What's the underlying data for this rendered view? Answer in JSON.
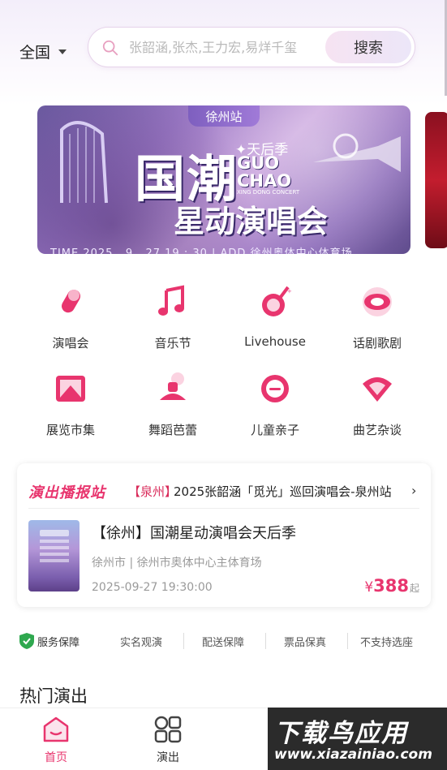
{
  "header": {
    "city": "全国",
    "search_placeholder": "张韶涵,张杰,王力宏,易烊千玺",
    "search_button": "搜索"
  },
  "banner": {
    "station": "徐州站",
    "title_line1": "国潮",
    "season": "✦天后季",
    "guo": "GUO",
    "chao": "CHAO",
    "sub_en": "XING DONG CONCERT",
    "title_line2": "星动演唱会",
    "time": "TIME 2025 . 9 . 27 19 : 30 | ADD 徐州奥体中心体育场"
  },
  "categories": [
    {
      "label": "演唱会",
      "icon": "microphone-icon"
    },
    {
      "label": "音乐节",
      "icon": "music-note-icon"
    },
    {
      "label": "Livehouse",
      "icon": "guitar-icon"
    },
    {
      "label": "话剧歌剧",
      "icon": "drama-mask-icon"
    },
    {
      "label": "展览市集",
      "icon": "picture-frame-icon"
    },
    {
      "label": "舞蹈芭蕾",
      "icon": "ballet-skirt-icon"
    },
    {
      "label": "儿童亲子",
      "icon": "child-face-icon"
    },
    {
      "label": "曲艺杂谈",
      "icon": "folding-fan-icon"
    }
  ],
  "broadcast": {
    "title": "演出播报站",
    "city_tag": "【泉州】",
    "text": "2025张韶涵「觅光」巡回演唱会-泉州站"
  },
  "show": {
    "title": "【徐州】国潮星动演唱会天后季",
    "venue": "徐州市 | 徐州市奥体中心主体育场",
    "time": "2025-09-27 19:30:00",
    "price_currency": "¥",
    "price": "388",
    "price_suffix": "起"
  },
  "service": {
    "label": "服务保障",
    "items": [
      "实名观演",
      "配送保障",
      "票品保真",
      "不支持选座"
    ]
  },
  "hot_title": "热门演出",
  "tabbar": {
    "tabs": [
      {
        "label": "首页",
        "active": true
      },
      {
        "label": "演出",
        "active": false
      }
    ]
  },
  "watermark": {
    "line1": "下载鸟应用",
    "line2": "www.xiazainiao.com"
  },
  "colors": {
    "accent": "#e8356e",
    "service_shield": "#2fa84f"
  }
}
